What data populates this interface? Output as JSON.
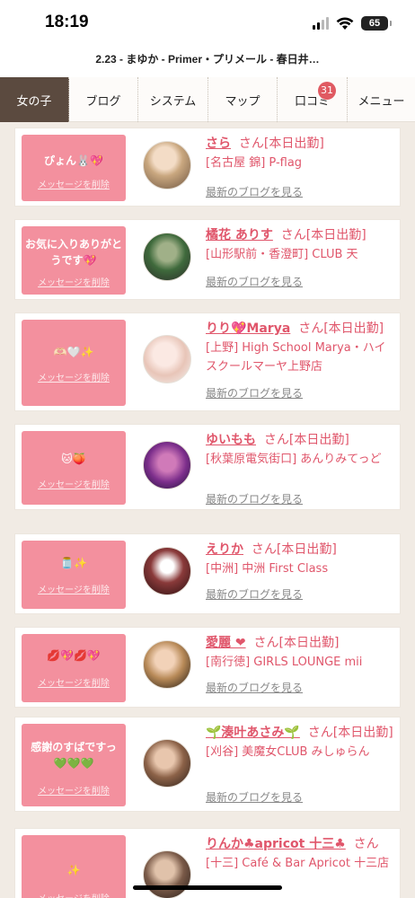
{
  "status": {
    "time": "18:19",
    "battery": "65"
  },
  "page_title": "2.23 - まゆか - Primer・プリメール - 春日井…",
  "tabs": [
    {
      "label": "女の子",
      "active": true
    },
    {
      "label": "ブログ"
    },
    {
      "label": "システム"
    },
    {
      "label": "マップ"
    },
    {
      "label": "口コミ",
      "badge": "31"
    },
    {
      "label": "メニュー"
    }
  ],
  "delete_label": "メッセージを削除",
  "blog_label": "最新のブログを見る",
  "entries": [
    {
      "message": "ぴょん🐰💖",
      "name": "さら",
      "suffix": "さん[本日出勤]",
      "shop": "[名古屋 錦] P-flag"
    },
    {
      "message": "お気に入りありがとうです💖",
      "name": "橘花 ありす",
      "suffix": "さん[本日出勤]",
      "shop": "[山形駅前・香澄町] CLUB 天"
    },
    {
      "message": "🫶🏻🤍✨",
      "name": "りり💖Marya",
      "suffix": "さん[本日出勤]",
      "shop": "[上野] High School Marya・ハイスクールマーヤ上野店"
    },
    {
      "message": "🐱🍑",
      "name": "ゆいもも",
      "suffix": "さん[本日出勤]",
      "shop": "[秋葉原電気街口] あんりみてっど"
    },
    {
      "message": "🫙✨",
      "name": "えりか",
      "suffix": "さん[本日出勤]",
      "shop": "[中洲] 中洲 First Class"
    },
    {
      "message": "💋💖💋💖",
      "name": "愛麗 ❤",
      "suffix": "さん[本日出勤]",
      "shop": "[南行徳] GIRLS LOUNGE mii"
    },
    {
      "message": "感謝のすばですっ💚💚💚",
      "name": "🌱湊叶あさみ🌱",
      "suffix": "さん[本日出勤]",
      "shop": "[刈谷] 美魔女CLUB みしゅらん"
    },
    {
      "message": "✨",
      "name": "りんか♣apricot 十三♣",
      "suffix": "さん",
      "shop": "[十三] Café & Bar Apricot 十三店"
    }
  ]
}
